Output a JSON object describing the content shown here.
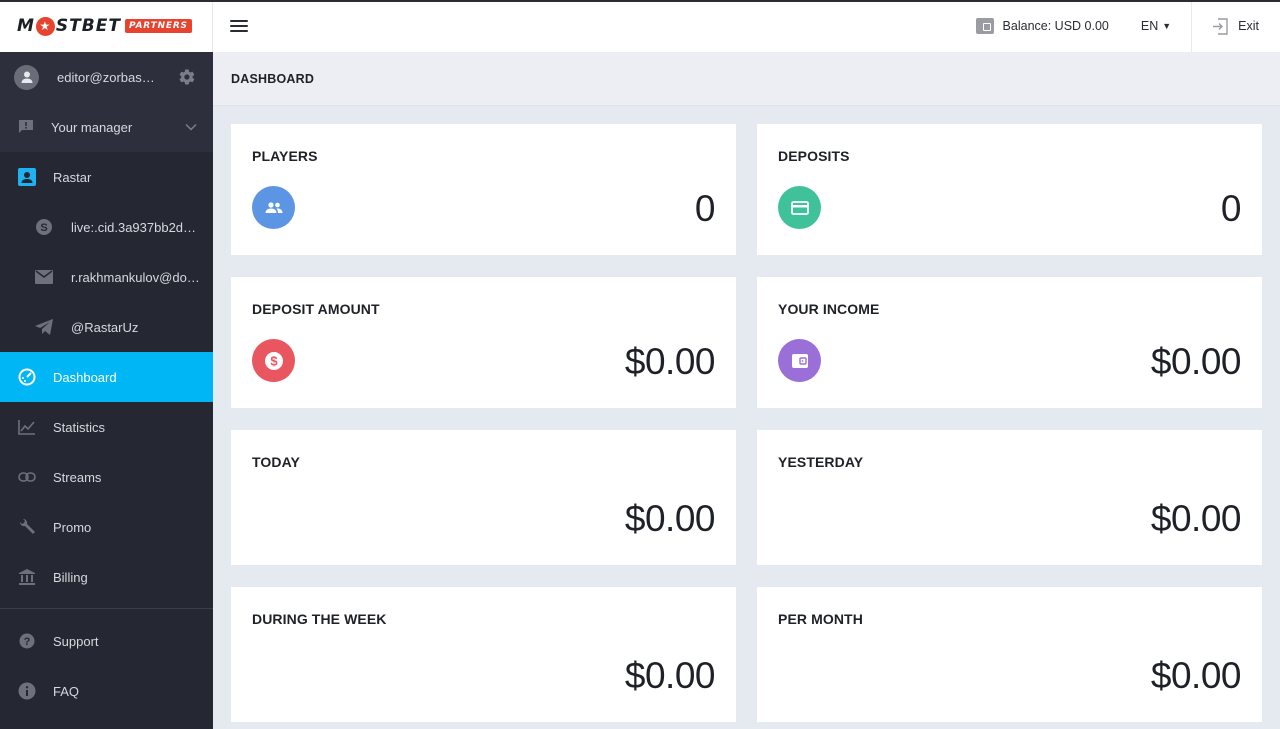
{
  "app": {
    "logo_main_left": "M",
    "logo_main_right": "STBET",
    "logo_badge": "PARTNERS",
    "brand_color": "#e8432e",
    "accent_color": "#00b6f5"
  },
  "sidebar": {
    "user_email": "editor@zorbas…",
    "manager_label": "Your manager",
    "manager": {
      "name": "Rastar",
      "skype": "live:.cid.3a937bb2d…",
      "email": "r.rakhmankulov@do…",
      "telegram": "@RastarUz"
    },
    "nav": [
      {
        "label": "Dashboard",
        "icon": "dashboard-icon",
        "active": true
      },
      {
        "label": "Statistics",
        "icon": "chart-icon"
      },
      {
        "label": "Streams",
        "icon": "link-icon"
      },
      {
        "label": "Promo",
        "icon": "wrench-icon"
      },
      {
        "label": "Billing",
        "icon": "bank-icon"
      }
    ],
    "bottom": [
      {
        "label": "Support",
        "icon": "help-icon"
      },
      {
        "label": "FAQ",
        "icon": "info-icon"
      }
    ]
  },
  "header": {
    "balance": "Balance: USD 0.00",
    "language": "EN",
    "exit_label": "Exit"
  },
  "page": {
    "title": "DASHBOARD"
  },
  "cards": [
    {
      "title": "PLAYERS",
      "value": "0",
      "icon": "users-icon",
      "color": "#5b95e4"
    },
    {
      "title": "DEPOSITS",
      "value": "0",
      "icon": "card-icon",
      "color": "#3fc29a"
    },
    {
      "title": "DEPOSIT AMOUNT",
      "value": "$0.00",
      "icon": "dollar-icon",
      "color": "#e9565f"
    },
    {
      "title": "YOUR INCOME",
      "value": "$0.00",
      "icon": "wallet-icon",
      "color": "#9b6fd8"
    },
    {
      "title": "TODAY",
      "value": "$0.00"
    },
    {
      "title": "YESTERDAY",
      "value": "$0.00"
    },
    {
      "title": "DURING THE WEEK",
      "value": "$0.00"
    },
    {
      "title": "PER MONTH",
      "value": "$0.00"
    }
  ]
}
